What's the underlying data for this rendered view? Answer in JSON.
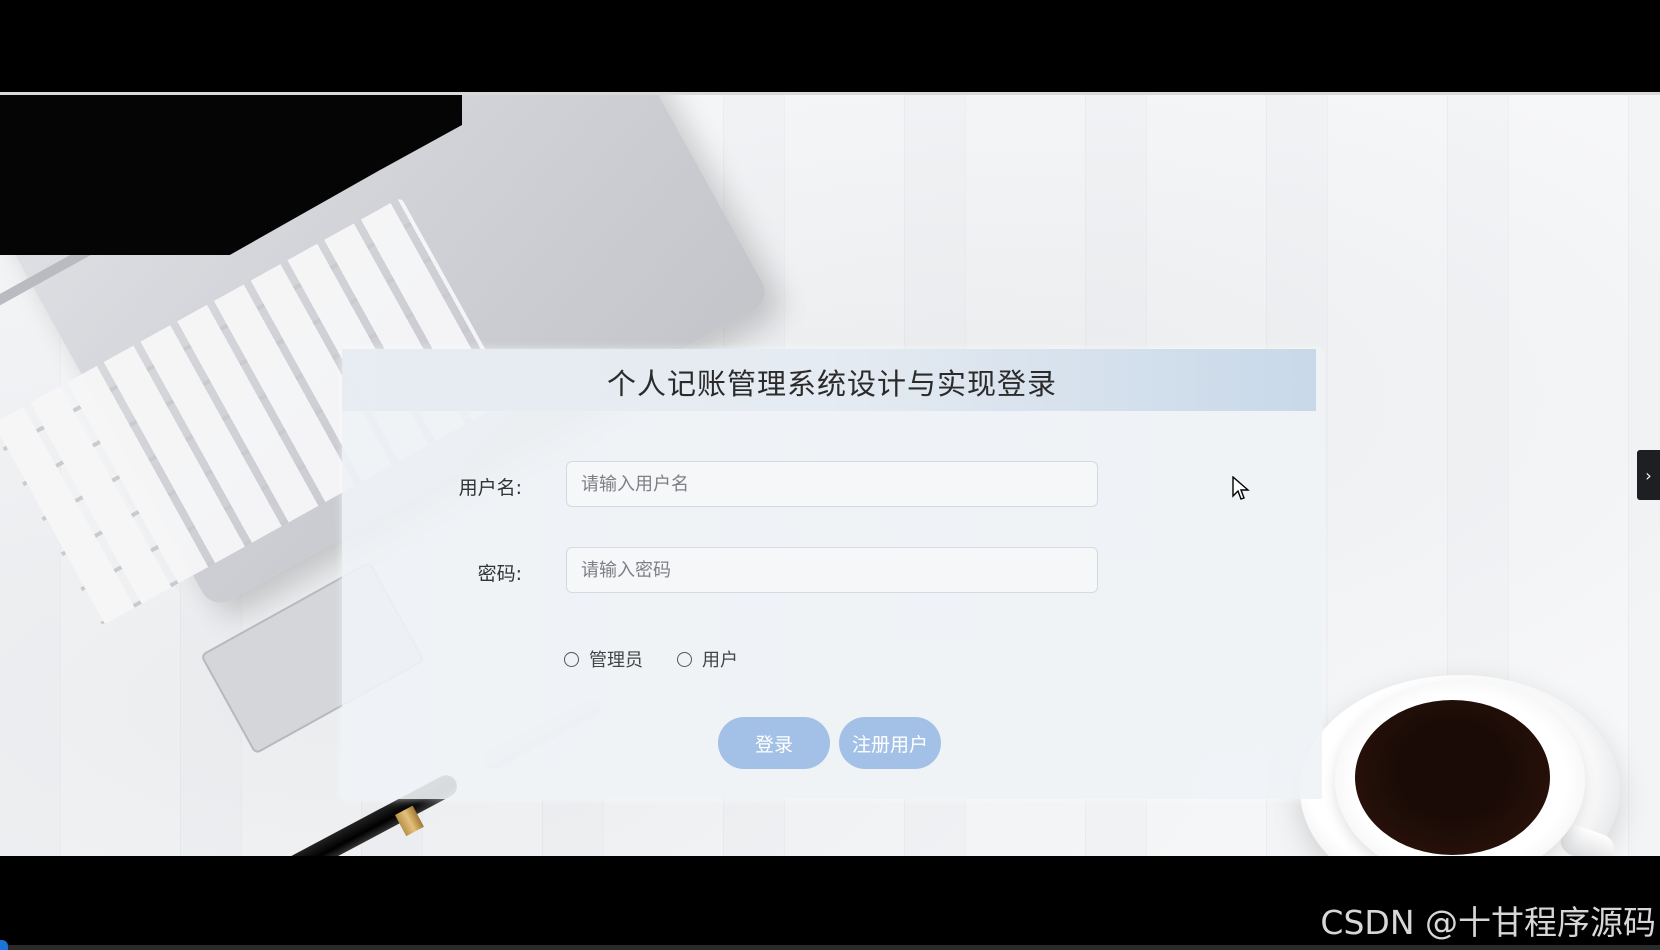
{
  "login": {
    "title": "个人记账管理系统设计与实现登录",
    "username_label": "用户名:",
    "username_placeholder": "请输入用户名",
    "username_value": "",
    "password_label": "密码:",
    "password_placeholder": "请输入密码",
    "password_value": "",
    "roles": [
      {
        "label": "管理员",
        "selected": false
      },
      {
        "label": "用户",
        "selected": false
      }
    ],
    "login_button": "登录",
    "register_button": "注册用户"
  },
  "side_arrow": "›",
  "watermark": "CSDN @十甘程序源码",
  "colors": {
    "button": "#a3c1e6",
    "header_gradient_end": "#c6d7e8"
  }
}
